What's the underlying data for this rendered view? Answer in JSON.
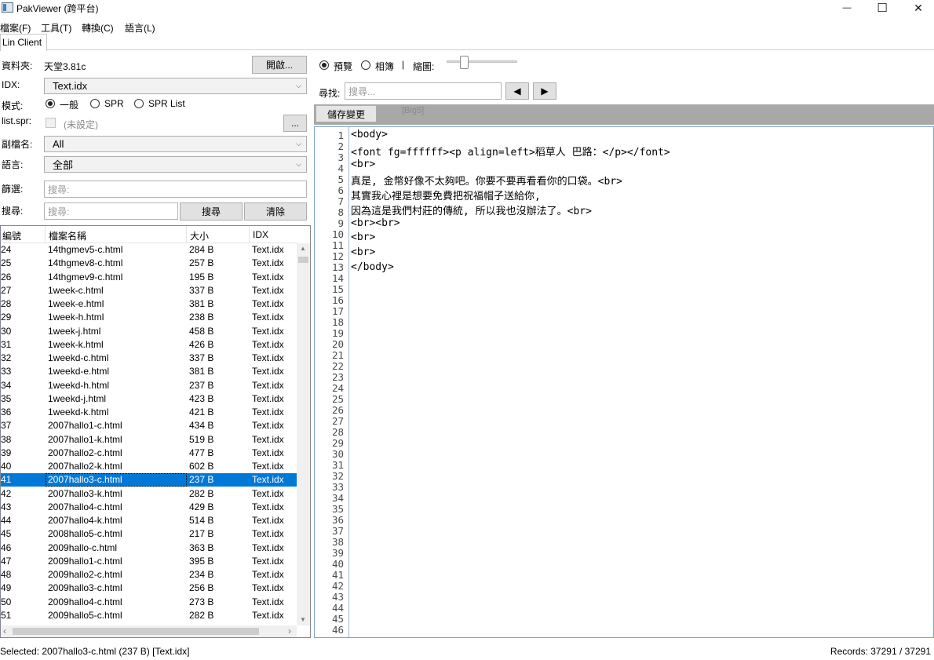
{
  "window": {
    "title": "PakViewer (跨平台)",
    "minimize_glyph": "—",
    "maximize_glyph": "☐",
    "close_glyph": "✕"
  },
  "menu": [
    "檔案(F)",
    "工具(T)",
    "轉換(C)",
    "語言(L)"
  ],
  "tabs": [
    {
      "label": "Lin Client",
      "active": true
    }
  ],
  "left": {
    "folder_label": "資料夾:",
    "folder_value": "天堂3.81c",
    "open_button": "開啟...",
    "idx_label": "IDX:",
    "idx_value": "Text.idx",
    "mode_label": "模式:",
    "modes": [
      {
        "label": "一般",
        "checked": true
      },
      {
        "label": "SPR",
        "checked": false
      },
      {
        "label": "SPR List",
        "checked": false
      }
    ],
    "listspr_label": "list.spr:",
    "listspr_value": "(未設定)",
    "listspr_browse": "...",
    "ext_label": "副檔名:",
    "ext_value": "All",
    "lang_label": "語言:",
    "lang_value": "全部",
    "filter_label": "篩選:",
    "filter_placeholder": "搜尋:",
    "search_label": "搜尋:",
    "search_placeholder": "搜尋:",
    "search_button": "搜尋",
    "clear_button": "清除",
    "columns": [
      "編號",
      "檔案名稱",
      "大小",
      "IDX"
    ],
    "rows": [
      [
        "24",
        "14thgmev5-c.html",
        "284 B",
        "Text.idx"
      ],
      [
        "25",
        "14thgmev8-c.html",
        "257 B",
        "Text.idx"
      ],
      [
        "26",
        "14thgmev9-c.html",
        "195 B",
        "Text.idx"
      ],
      [
        "27",
        "1week-c.html",
        "337 B",
        "Text.idx"
      ],
      [
        "28",
        "1week-e.html",
        "381 B",
        "Text.idx"
      ],
      [
        "29",
        "1week-h.html",
        "238 B",
        "Text.idx"
      ],
      [
        "30",
        "1week-j.html",
        "458 B",
        "Text.idx"
      ],
      [
        "31",
        "1week-k.html",
        "426 B",
        "Text.idx"
      ],
      [
        "32",
        "1weekd-c.html",
        "337 B",
        "Text.idx"
      ],
      [
        "33",
        "1weekd-e.html",
        "381 B",
        "Text.idx"
      ],
      [
        "34",
        "1weekd-h.html",
        "237 B",
        "Text.idx"
      ],
      [
        "35",
        "1weekd-j.html",
        "423 B",
        "Text.idx"
      ],
      [
        "36",
        "1weekd-k.html",
        "421 B",
        "Text.idx"
      ],
      [
        "37",
        "2007hallo1-c.html",
        "434 B",
        "Text.idx"
      ],
      [
        "38",
        "2007hallo1-k.html",
        "519 B",
        "Text.idx"
      ],
      [
        "39",
        "2007hallo2-c.html",
        "477 B",
        "Text.idx"
      ],
      [
        "40",
        "2007hallo2-k.html",
        "602 B",
        "Text.idx"
      ],
      [
        "41",
        "2007hallo3-c.html",
        "237 B",
        "Text.idx"
      ],
      [
        "42",
        "2007hallo3-k.html",
        "282 B",
        "Text.idx"
      ],
      [
        "43",
        "2007hallo4-c.html",
        "429 B",
        "Text.idx"
      ],
      [
        "44",
        "2007hallo4-k.html",
        "514 B",
        "Text.idx"
      ],
      [
        "45",
        "2008hallo5-c.html",
        "217 B",
        "Text.idx"
      ],
      [
        "46",
        "2009hallo-c.html",
        "363 B",
        "Text.idx"
      ],
      [
        "47",
        "2009hallo1-c.html",
        "395 B",
        "Text.idx"
      ],
      [
        "48",
        "2009hallo2-c.html",
        "234 B",
        "Text.idx"
      ],
      [
        "49",
        "2009hallo3-c.html",
        "256 B",
        "Text.idx"
      ],
      [
        "50",
        "2009hallo4-c.html",
        "273 B",
        "Text.idx"
      ],
      [
        "51",
        "2009hallo5-c.html",
        "282 B",
        "Text.idx"
      ]
    ],
    "selected_row_index": 17
  },
  "right": {
    "view_modes": [
      {
        "label": "預覽",
        "checked": true
      },
      {
        "label": "相簿",
        "checked": false
      }
    ],
    "separator": "|",
    "zoom_label": "縮圖:",
    "zoom_level": 0.22,
    "find_label": "尋找:",
    "find_placeholder": "搜尋...",
    "find_prev_glyph": "◀",
    "find_next_glyph": "▶",
    "save_button": "儲存變更",
    "encoding": "[Big5]",
    "code_lines": [
      "<body>",
      "<font fg=ffffff><p align=left>稻草人 巴路：</p></font>",
      "",
      "<br>",
      "真是, 金幣好像不太夠吧。你要不要再看看你的口袋。<br>",
      "其實我心裡是想要免費把祝福帽子送給你,",
      "因為這是我們村莊的傳統, 所以我也沒辦法了。<br>",
      "",
      "<br><br>",
      "",
      "<br>",
      "<br>",
      "</body>"
    ],
    "line_count": 46
  },
  "status": {
    "selected": "Selected: 2007hallo3-c.html (237 B) [Text.idx]",
    "records": "Records: 37291 / 37291"
  }
}
